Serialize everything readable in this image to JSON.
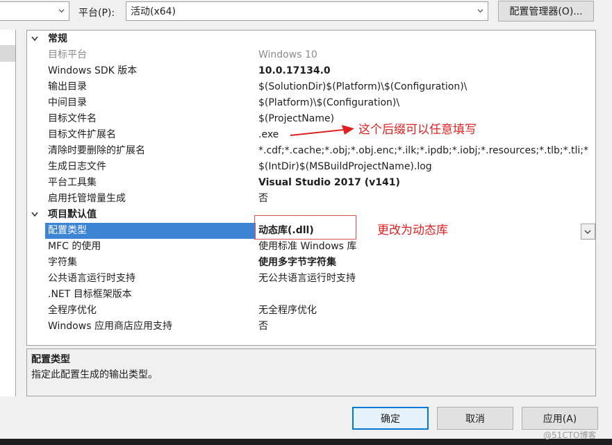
{
  "toolbar": {
    "platform_label": "平台(P):",
    "platform_value": "活动(x64)",
    "config_manager_label": "配置管理器(O)..."
  },
  "properties": {
    "categories": [
      {
        "label": "常规",
        "rows": [
          {
            "name": "目标平台",
            "value": "Windows 10",
            "disabled": true
          },
          {
            "name": "Windows SDK 版本",
            "value": "10.0.17134.0",
            "bold": true
          },
          {
            "name": "输出目录",
            "value": "$(SolutionDir)$(Platform)\\$(Configuration)\\"
          },
          {
            "name": "中间目录",
            "value": "$(Platform)\\$(Configuration)\\"
          },
          {
            "name": "目标文件名",
            "value": "$(ProjectName)"
          },
          {
            "name": "目标文件扩展名",
            "value": ".exe"
          },
          {
            "name": "清除时要删除的扩展名",
            "value": "*.cdf;*.cache;*.obj;*.obj.enc;*.ilk;*.ipdb;*.iobj;*.resources;*.tlb;*.tli;*"
          },
          {
            "name": "生成日志文件",
            "value": "$(IntDir)$(MSBuildProjectName).log"
          },
          {
            "name": "平台工具集",
            "value": "Visual Studio 2017 (v141)",
            "bold": true
          },
          {
            "name": "启用托管增量生成",
            "value": "否"
          }
        ]
      },
      {
        "label": "项目默认值",
        "rows": [
          {
            "name": "配置类型",
            "value": "动态库(.dll)",
            "bold": true,
            "selected": true
          },
          {
            "name": "MFC 的使用",
            "value": "使用标准 Windows 库"
          },
          {
            "name": "字符集",
            "value": "使用多字节字符集",
            "bold": true
          },
          {
            "name": "公共语言运行时支持",
            "value": "无公共语言运行时支持"
          },
          {
            "name": ".NET 目标框架版本",
            "value": ""
          },
          {
            "name": "全程序优化",
            "value": "无全程序优化"
          },
          {
            "name": "Windows 应用商店应用支持",
            "value": "否"
          }
        ]
      }
    ]
  },
  "annotations": {
    "extension_note": "这个后缀可以任意填写",
    "type_note": "更改为动态库"
  },
  "description": {
    "title": "配置类型",
    "text": "指定此配置生成的输出类型。"
  },
  "buttons": {
    "ok": "确定",
    "cancel": "取消",
    "apply": "应用(A)"
  },
  "watermark": "@51CTO博客"
}
